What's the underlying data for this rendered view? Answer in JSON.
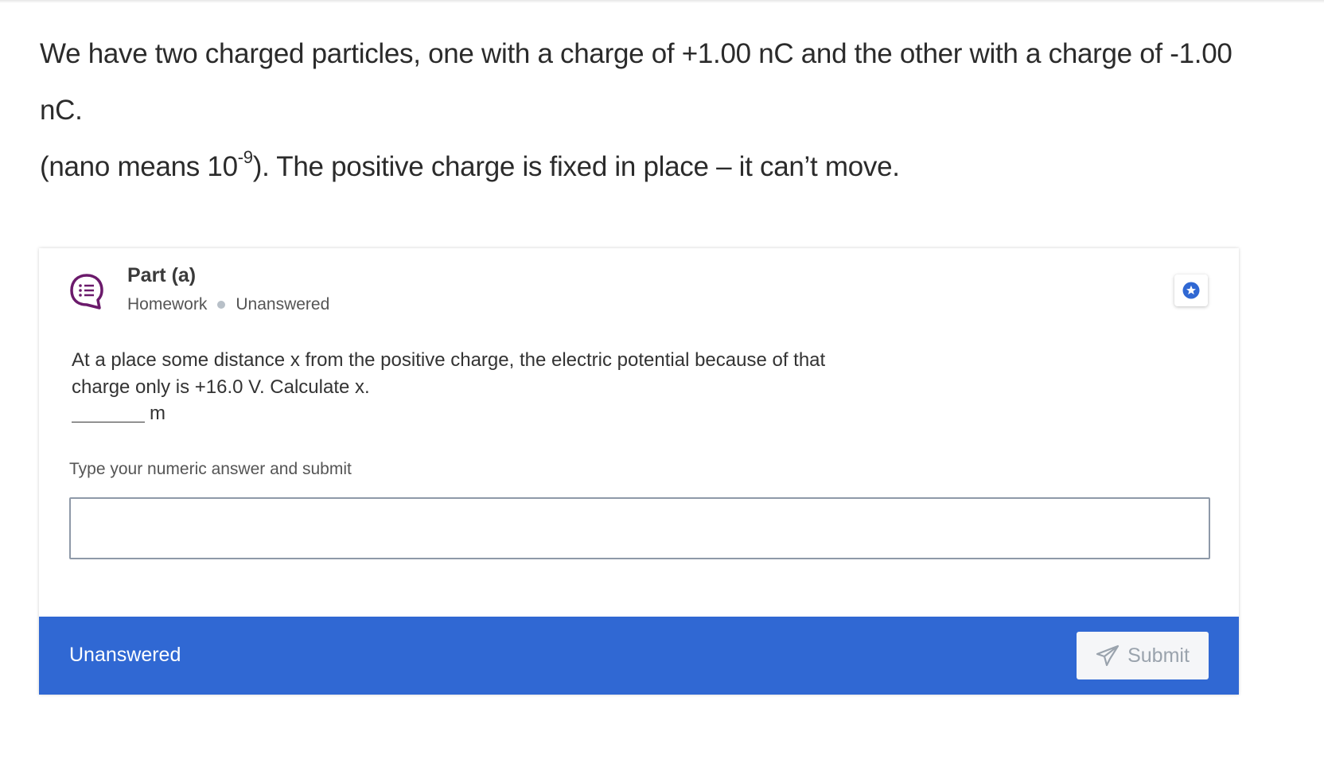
{
  "intro": {
    "line1": "We have two charged particles, one with a charge of +1.00 nC and the other with a charge of -1.00 nC.",
    "line2_before": "(nano means 10",
    "line2_sup": "-9",
    "line2_after": "). The positive charge is fixed in place – it can’t move."
  },
  "part": {
    "icon": "question-list-icon",
    "title": "Part (a)",
    "type": "Homework",
    "status": "Unanswered",
    "bookmark_icon": "star-icon",
    "question_line1": "At a place some distance x from the positive charge, the electric potential because of that",
    "question_line2": "charge only is +16.0 V. Calculate x.",
    "answer_unit": "m",
    "prompt": "Type your numeric answer and submit",
    "answer_value": "",
    "answer_placeholder": ""
  },
  "footer": {
    "status": "Unanswered",
    "submit_label": "Submit",
    "submit_icon": "paper-plane-icon",
    "color": "#3068d3"
  },
  "colors": {
    "accent": "#3068d3",
    "icon_purple": "#6b1a6b"
  }
}
